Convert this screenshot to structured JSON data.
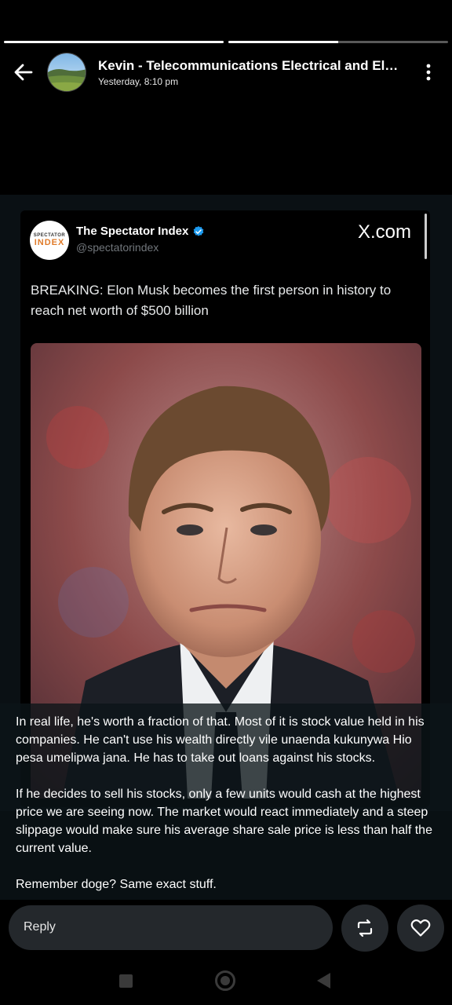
{
  "story_progress": [
    1.0,
    0.5
  ],
  "header": {
    "title": "Kevin - Telecommunications Electrical and Electronics",
    "timestamp": "Yesterday, 8:10 pm",
    "back_icon": "arrow-left-icon",
    "menu_icon": "more-vertical-icon"
  },
  "tweet": {
    "logo_line1": "SPECTATOR",
    "logo_line2": "INDEX",
    "author": "The Spectator Index",
    "handle": "@spectatorindex",
    "source": "X.com",
    "text": "BREAKING: Elon Musk becomes the first person in history to reach net worth of $500 billion"
  },
  "caption": {
    "paragraph1": "In real life, he's worth a fraction of that. Most of it is stock value held in his companies. He can't use his wealth directly vile unaenda kukunywa Hio pesa umelipwa jana. He has to take out loans against his stocks.",
    "paragraph2": "If he decides to sell his stocks, only a few units would cash at the highest price we are seeing now. The market would react immediately and a steep slippage would make sure his average share sale price is less than half the current value.",
    "paragraph3": "Remember doge? Same exact stuff."
  },
  "reply": {
    "label": "Reply"
  },
  "colors": {
    "background": "#000000",
    "content_bg": "#0a1014",
    "button_bg": "#24282c",
    "verified_blue": "#1d9bf0"
  }
}
